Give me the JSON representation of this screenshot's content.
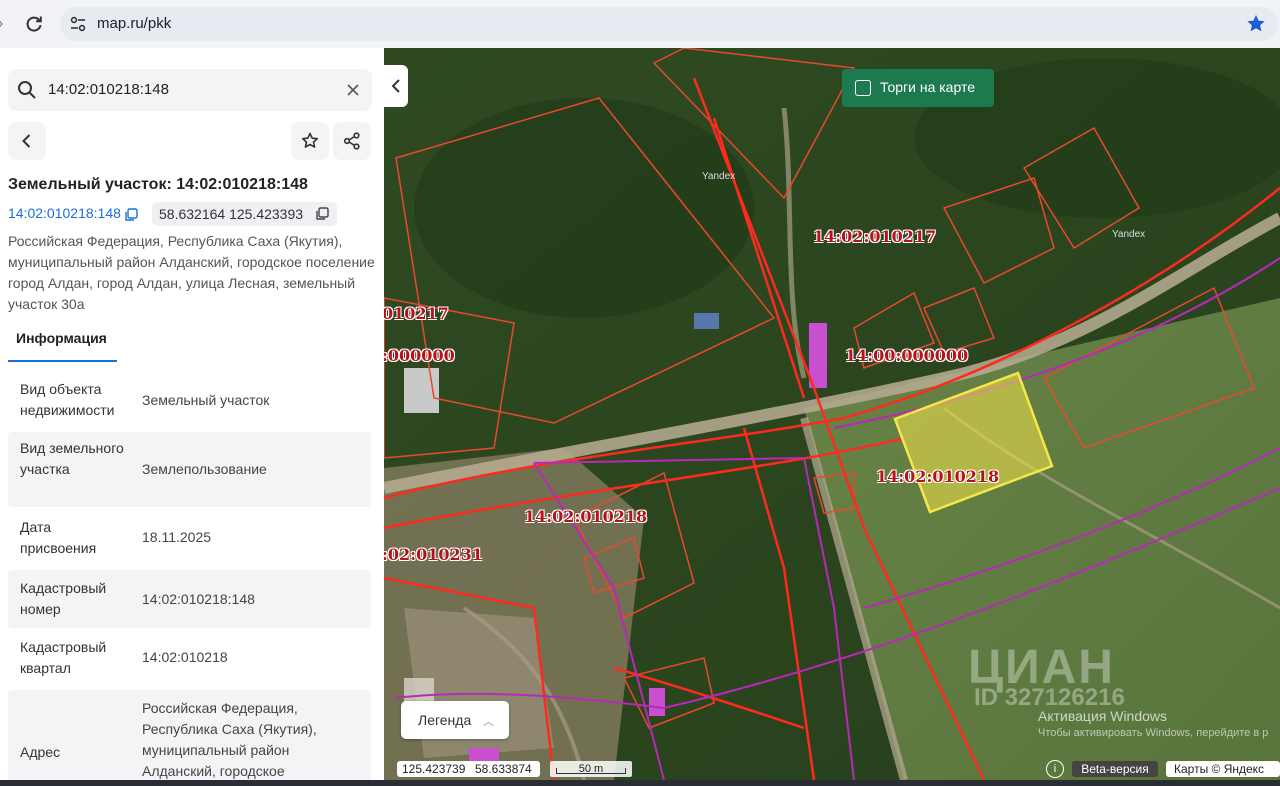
{
  "browser": {
    "url": "map.ru/pkk"
  },
  "search": {
    "value": "14:02:010218:148"
  },
  "parcel": {
    "title": "Земельный участок: 14:02:010218:148",
    "cadastral_link": "14:02:010218:148",
    "coordinates": "58.632164 125.423393",
    "address": "Российская Федерация, Республика Саха (Якутия), муниципальный район Алданский, городское поселение город Алдан, город Алдан, улица Лесная, земельный участок 30а"
  },
  "tabs": {
    "info": "Информация"
  },
  "info_rows": [
    {
      "key": "Вид объекта недвижимости",
      "value": "Земельный участок"
    },
    {
      "key": "Вид земельного участка",
      "value": "Землепользование"
    },
    {
      "key": "Дата присвоения",
      "value": "18.11.2025"
    },
    {
      "key": "Кадастровый номер",
      "value": "14:02:010218:148"
    },
    {
      "key": "Кадастровый квартал",
      "value": "14:02:010218"
    },
    {
      "key": "Адрес",
      "value": "Российская Федерация, Республика Саха (Якутия), муниципальный район Алданский, городское"
    }
  ],
  "map": {
    "torgi_label": "Торги на карте",
    "legend_label": "Легенда",
    "labels": {
      "q217": "14:02:010217",
      "q217_partial": "010217",
      "zero_left": ":000000",
      "zero_center": "14:00:000000",
      "q218_selected": "14:02:010218",
      "q218_left": "14:02:010218",
      "q231": ":02:010231"
    },
    "yandex_tiles": "Yandex",
    "cursor_lon": "125.423739",
    "cursor_lat": "58.633874",
    "scale": "50 m",
    "beta": "Beta-версия",
    "copyright": "Карты © Яндекс",
    "watermark": "ЦИАН",
    "watermark_id": "ID 327126216",
    "activation_title": "Активация Windows",
    "activation_sub": "Чтобы активировать Windows, перейдите в р"
  },
  "colors": {
    "accent_blue": "#1a6ee0",
    "cadastre_red": "#e0302a",
    "selected_fill": "#f5e64a",
    "torgi_green": "#1d7a4e"
  }
}
